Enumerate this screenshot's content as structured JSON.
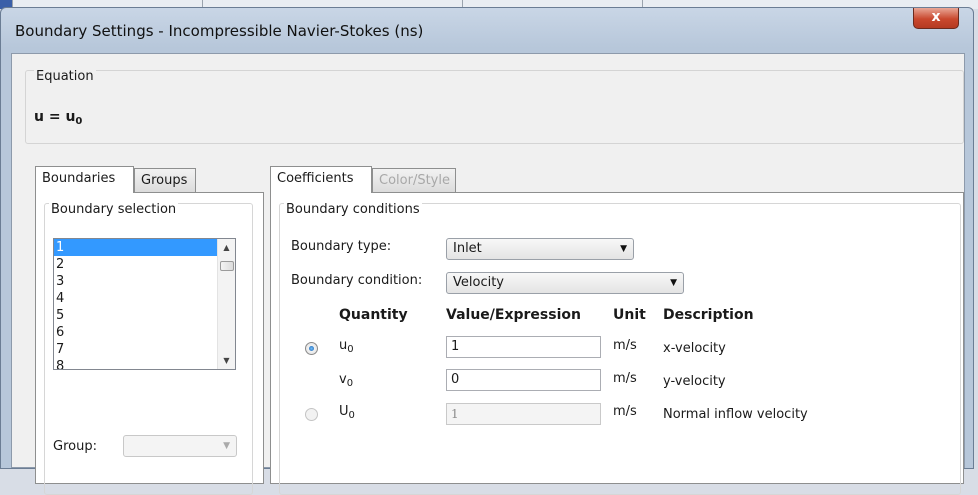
{
  "window": {
    "title": "Boundary Settings - Incompressible Navier-Stokes (ns)",
    "close_label": "x"
  },
  "equation": {
    "group_label": "Equation",
    "text": "u = u",
    "sub": "0"
  },
  "left_tabs": [
    "Boundaries",
    "Groups"
  ],
  "boundary_selection": {
    "label": "Boundary selection",
    "items": [
      "1",
      "2",
      "3",
      "4",
      "5",
      "6",
      "7",
      "8"
    ],
    "selected": "1",
    "group_label": "Group:",
    "group_value": ""
  },
  "right_tabs": [
    "Coefficients",
    "Color/Style"
  ],
  "boundary_conditions": {
    "label": "Boundary conditions",
    "type_label": "Boundary type:",
    "type_value": "Inlet",
    "condition_label": "Boundary condition:",
    "condition_value": "Velocity"
  },
  "table": {
    "headers": {
      "quantity": "Quantity",
      "value": "Value/Expression",
      "unit": "Unit",
      "description": "Description"
    },
    "rows": [
      {
        "quantity": "u",
        "sub": "0",
        "value": "1",
        "unit": "m/s",
        "description": "x-velocity",
        "radio": "checked"
      },
      {
        "quantity": "v",
        "sub": "0",
        "value": "0",
        "unit": "m/s",
        "description": "y-velocity",
        "radio": "none"
      },
      {
        "quantity": "U",
        "sub": "0",
        "value": "1",
        "unit": "m/s",
        "description": "Normal inflow velocity",
        "radio": "unchecked-disabled"
      }
    ]
  },
  "icons": {
    "dropdown": "chevron-down-icon",
    "scroll_up": "scroll-up-icon",
    "scroll_down": "scroll-down-icon"
  }
}
